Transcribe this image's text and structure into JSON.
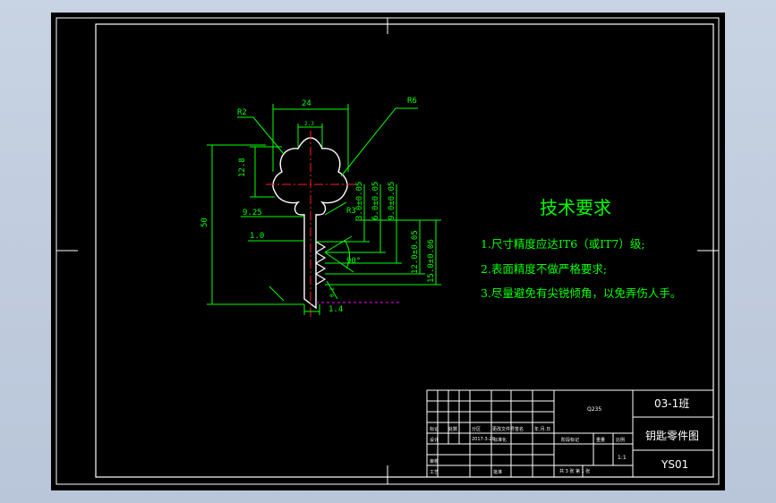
{
  "dimensions": {
    "width_24": "24",
    "r6": "R6",
    "r2": "R2",
    "h_12_8": "12.8",
    "w_2_3": "2.3",
    "h_50": "50",
    "r3": "R3",
    "d_9_25": "9.25",
    "d_1_0": "1.0",
    "d_3_0": "3.0±0.05",
    "d_6_0": "6.0±0.05",
    "d_9_0": "9.0±0.05",
    "d_12_0": "12.0±0.05",
    "d_15_0": "15.0±0.06",
    "angle_90": "90°",
    "w_1_4": "1.4",
    "d_0_2": "0.2"
  },
  "requirements": {
    "title": "技术要求",
    "items": [
      "1.尺寸精度应达IT6（或IT7）级;",
      "2.表面精度不做严格要求;",
      "3.尽量避免有尖锐倾角，以免弄伤人手。"
    ]
  },
  "title_block": {
    "class_name": "03-1班",
    "drawing_name": "钥匙零件图",
    "drawing_code": "YS01",
    "material": "Q235",
    "scale": "1:1",
    "sheet_info": "共 3 张  第 1 张",
    "row_labels": [
      "标记",
      "处数",
      "分区",
      "更改文件号",
      "签名",
      "年.月.日"
    ],
    "design_label": "设计",
    "design_date": "2017-3-20",
    "standard_label": "标准化",
    "stage_label": "阶段标记",
    "weight_label": "重量",
    "scale_label": "比例",
    "review_label": "审核",
    "process_label": "工艺",
    "approve_label": "批准"
  }
}
